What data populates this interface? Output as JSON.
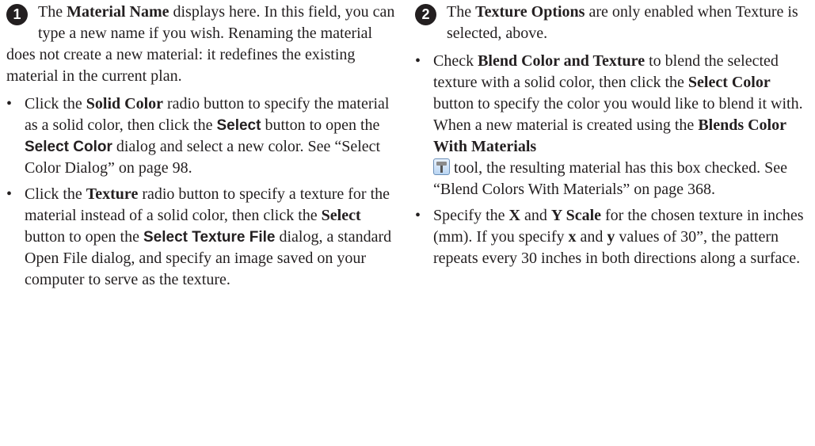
{
  "col1": {
    "marker": "1",
    "intro": {
      "t1": "The ",
      "b1": "Material Name",
      "t2": " displays here. In this field, you can type a new name if you wish. Renaming the material does not create a new material: it redefines the existing material in the current plan."
    },
    "bullet1": {
      "t1": "Click the ",
      "b1": "Solid Color",
      "t2": " radio button to specify the material as a solid color, then click the ",
      "s1": "Select",
      "t3": " button to open the ",
      "s2": "Select Color",
      "t4": " dialog and select a new color. See “Select Color Dialog” on page 98."
    },
    "bullet2": {
      "t1": "Click the ",
      "b1": "Texture",
      "t2": " radio button to specify a texture for the material instead of a solid color, then click the ",
      "b2": "Select",
      "t3": " button to open the ",
      "s1": "Select Texture File",
      "t4": " dialog, a standard Open File dialog, and specify an image saved on your computer to serve as the texture."
    }
  },
  "col2": {
    "marker": "2",
    "intro": {
      "t1": "The ",
      "b1": "Texture Options",
      "t2": " are only enabled when Texture is selected, above."
    },
    "bullet1": {
      "t1": "Check ",
      "b1": "Blend Color and Texture",
      "t2": " to blend the selected texture with a solid color, then click the ",
      "b2": "Select Color",
      "t3": " button to specify the color you would like to blend it with. When a new material is created using the ",
      "b3": "Blends Color With Materials",
      "icon": "blend-colors-icon",
      "t4": " tool, the resulting material has this box checked. See “Blend Colors With Materials” on page 368."
    },
    "bullet2": {
      "t1": "Specify the ",
      "b1": "X",
      "t2": " and ",
      "b2": "Y Scale",
      "t3": " for the chosen texture in inches (mm). If you specify ",
      "b3": "x",
      "t4": " and ",
      "b4": "y",
      "t5": " values of 30”, the pattern repeats every 30 inches in both directions along a surface."
    }
  }
}
